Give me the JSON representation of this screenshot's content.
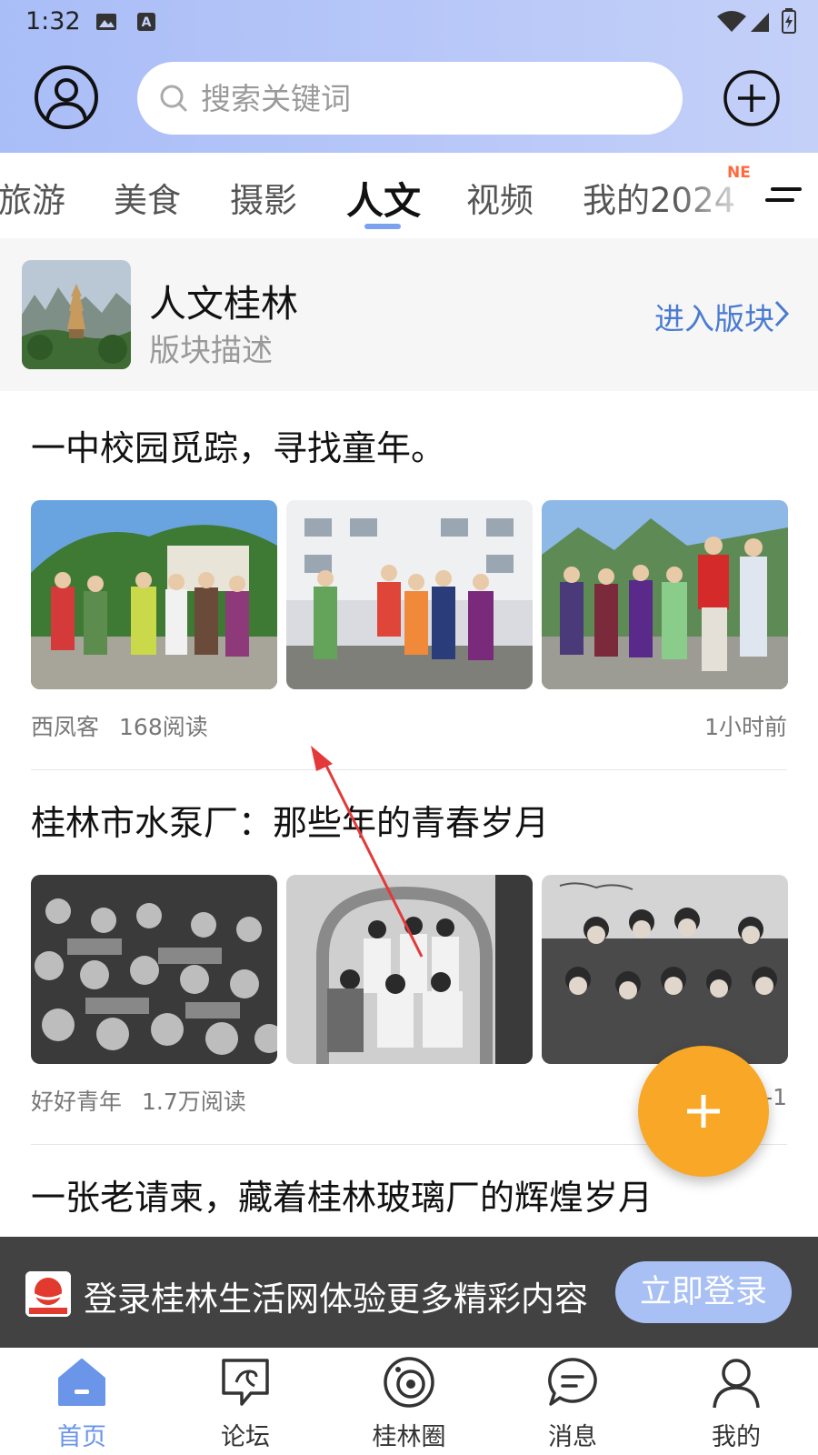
{
  "status_bar": {
    "time": "1:32"
  },
  "header": {
    "search_placeholder": "搜索关键词",
    "icons": [
      "user-avatar-icon",
      "search-icon",
      "add-circle-icon"
    ]
  },
  "tabs": {
    "items": [
      "旅游",
      "美食",
      "摄影",
      "人文",
      "视频",
      "我的2024"
    ],
    "active": "人文",
    "badge": "NE"
  },
  "section": {
    "name": "人文桂林",
    "description": "版块描述",
    "enter_label": "进入版块"
  },
  "posts": [
    {
      "title": "一中校园觅踪，寻找童年。",
      "author": "西凤客",
      "reads": "168阅读",
      "time": "1小时前"
    },
    {
      "title": "桂林市水泵厂：那些年的青春岁月",
      "author": "好好青年",
      "reads": "1.7万阅读",
      "time": "-1"
    },
    {
      "title": "一张老请柬，藏着桂林玻璃厂的辉煌岁月"
    }
  ],
  "login_banner": {
    "text": "登录桂林生活网体验更多精彩内容",
    "button": "立即登录"
  },
  "bottom_nav": [
    {
      "label": "首页",
      "icon": "home-icon",
      "active": true
    },
    {
      "label": "论坛",
      "icon": "forum-icon"
    },
    {
      "label": "桂林圈",
      "icon": "circle-icon"
    },
    {
      "label": "消息",
      "icon": "message-icon"
    },
    {
      "label": "我的",
      "icon": "profile-icon"
    }
  ],
  "colors": {
    "accent": "#6a95e8",
    "fab": "#f8a726",
    "header_bg": "#b3c5f7"
  }
}
